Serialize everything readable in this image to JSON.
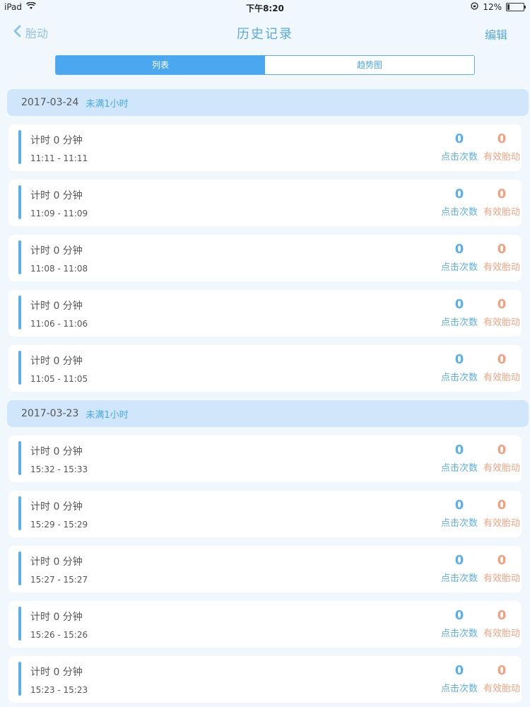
{
  "status_bar": {
    "device": "iPad",
    "time": "下午8:20",
    "battery_percent": "12%"
  },
  "nav": {
    "back_label": "胎动",
    "title": "历史记录",
    "edit_label": "编辑"
  },
  "segments": [
    {
      "label": "列表",
      "active": true
    },
    {
      "label": "趋势图",
      "active": false
    }
  ],
  "labels": {
    "clicks": "点击次数",
    "valid": "有效胎动"
  },
  "colors": {
    "accent": "#4ba7ef",
    "clicks": "#5ab0ef",
    "valid": "#f4a07e",
    "header_bg": "#cfe6fb"
  },
  "groups": [
    {
      "date": "2017-03-24",
      "note": "未满1小时",
      "records": [
        {
          "duration": "计时 0 分钟",
          "time_range": "11:11 - 11:11",
          "clicks": "0",
          "valid": "0"
        },
        {
          "duration": "计时 0 分钟",
          "time_range": "11:09 - 11:09",
          "clicks": "0",
          "valid": "0"
        },
        {
          "duration": "计时 0 分钟",
          "time_range": "11:08 - 11:08",
          "clicks": "0",
          "valid": "0"
        },
        {
          "duration": "计时 0 分钟",
          "time_range": "11:06 - 11:06",
          "clicks": "0",
          "valid": "0"
        },
        {
          "duration": "计时 0 分钟",
          "time_range": "11:05 - 11:05",
          "clicks": "0",
          "valid": "0"
        }
      ]
    },
    {
      "date": "2017-03-23",
      "note": "未满1小时",
      "records": [
        {
          "duration": "计时 0 分钟",
          "time_range": "15:32 - 15:33",
          "clicks": "0",
          "valid": "0"
        },
        {
          "duration": "计时 0 分钟",
          "time_range": "15:29 - 15:29",
          "clicks": "0",
          "valid": "0"
        },
        {
          "duration": "计时 0 分钟",
          "time_range": "15:27 - 15:27",
          "clicks": "0",
          "valid": "0"
        },
        {
          "duration": "计时 0 分钟",
          "time_range": "15:26 - 15:26",
          "clicks": "0",
          "valid": "0"
        },
        {
          "duration": "计时 0 分钟",
          "time_range": "15:23 - 15:23",
          "clicks": "0",
          "valid": "0"
        }
      ]
    }
  ]
}
